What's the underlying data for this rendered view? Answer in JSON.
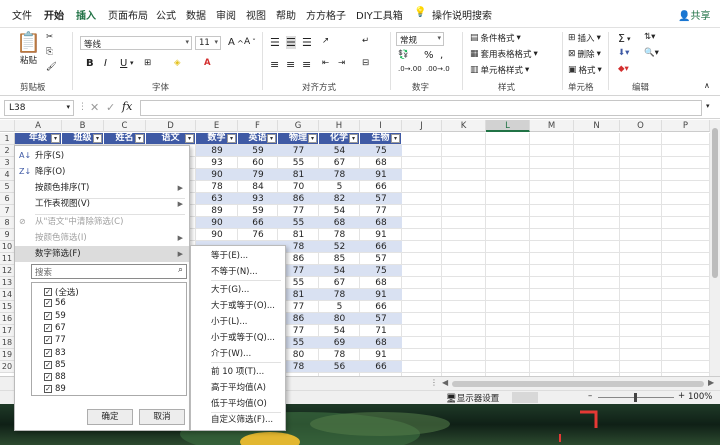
{
  "menubar": {
    "tabs": [
      "文件",
      "开始",
      "插入",
      "页面布局",
      "公式",
      "数据",
      "审阅",
      "视图",
      "帮助",
      "方方格子",
      "DIY工具箱"
    ],
    "active_tab": "插入",
    "tellme": "操作说明搜索",
    "share": "共享"
  },
  "ribbon": {
    "clipboard": {
      "paste": "粘贴",
      "label": "剪贴板"
    },
    "font": {
      "name": "等线",
      "size": "11",
      "grow": "A",
      "shrink": "A",
      "bold": "B",
      "italic": "I",
      "underline": "U",
      "label": "字体"
    },
    "alignment": {
      "label": "对齐方式"
    },
    "number": {
      "format": "常规",
      "percent": "%",
      "comma": ",",
      "label": "数字"
    },
    "styles": {
      "conditional": "条件格式",
      "table": "套用表格格式",
      "cell": "单元格样式",
      "label": "样式"
    },
    "cells": {
      "insert": "插入",
      "delete": "删除",
      "format": "格式",
      "label": "单元格"
    },
    "editing": {
      "sum": "Σ",
      "label": "编辑"
    }
  },
  "formula": {
    "namebox": "L38",
    "fx": "fx"
  },
  "columns": [
    "A",
    "B",
    "C",
    "D",
    "E",
    "F",
    "G",
    "H",
    "I",
    "J",
    "K",
    "L",
    "M",
    "N",
    "O",
    "P"
  ],
  "selected_column": "L",
  "headers": [
    "年级",
    "班级",
    "姓名",
    "语文",
    "数学",
    "英语",
    "物理",
    "化学",
    "生物"
  ],
  "row_numbers": [
    "1",
    "2",
    "3",
    "4",
    "5",
    "6",
    "7",
    "8",
    "9",
    "10",
    "11",
    "12",
    "13",
    "14",
    "15",
    "16",
    "17",
    "18",
    "19",
    "20"
  ],
  "rows": [
    [
      "89",
      "59",
      "77",
      "54",
      "75"
    ],
    [
      "93",
      "60",
      "55",
      "67",
      "68"
    ],
    [
      "90",
      "79",
      "81",
      "78",
      "91"
    ],
    [
      "78",
      "84",
      "70",
      "5",
      "66"
    ],
    [
      "63",
      "93",
      "86",
      "82",
      "57"
    ],
    [
      "89",
      "59",
      "77",
      "54",
      "77"
    ],
    [
      "90",
      "66",
      "55",
      "68",
      "68"
    ],
    [
      "90",
      "76",
      "81",
      "78",
      "91"
    ],
    [
      "",
      "",
      "78",
      "52",
      "66"
    ],
    [
      "",
      "",
      "86",
      "85",
      "57"
    ],
    [
      "",
      "",
      "77",
      "54",
      "75"
    ],
    [
      "",
      "",
      "55",
      "67",
      "68"
    ],
    [
      "",
      "",
      "81",
      "78",
      "91"
    ],
    [
      "",
      "",
      "77",
      "5",
      "66"
    ],
    [
      "",
      "",
      "86",
      "80",
      "57"
    ],
    [
      "",
      "",
      "77",
      "54",
      "71"
    ],
    [
      "",
      "",
      "55",
      "69",
      "68"
    ],
    [
      "",
      "",
      "80",
      "78",
      "91"
    ],
    [
      "",
      "",
      "78",
      "56",
      "66"
    ]
  ],
  "filter_menu": {
    "sort_asc": "升序(S)",
    "sort_desc": "降序(O)",
    "sort_color": "按颜色排序(T)",
    "sheet_view": "工作表视图(V)",
    "clear_filter": "从\"语文\"中清除筛选(C)",
    "filter_color": "按颜色筛选(I)",
    "number_filter": "数字筛选(F)",
    "search_placeholder": "搜索",
    "values": [
      "(全选)",
      "56",
      "59",
      "67",
      "77",
      "83",
      "85",
      "88",
      "89"
    ],
    "ok": "确定",
    "cancel": "取消"
  },
  "submenu": [
    "等于(E)...",
    "不等于(N)...",
    "大于(G)...",
    "大于或等于(O)...",
    "小于(L)...",
    "小于或等于(Q)...",
    "介于(W)...",
    "前 10 项(T)...",
    "高于平均值(A)",
    "低于平均值(O)",
    "自定义筛选(F)..."
  ],
  "statusbar": {
    "display_settings": "显示器设置",
    "zoom": "100%"
  }
}
